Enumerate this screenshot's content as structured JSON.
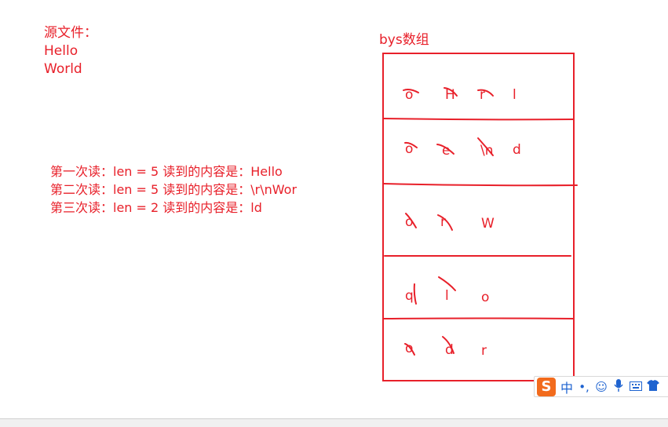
{
  "source_file": {
    "label": "源文件：",
    "lines": [
      "Hello",
      "World"
    ]
  },
  "reads": [
    "第一次读：len = 5 读到的内容是：Hello",
    "第二次读：len = 5 读到的内容是：\\r\\nWor",
    "第三次读：len = 2 读到的内容是：ld"
  ],
  "bys_array": {
    "title": "bys数组",
    "rows": [
      [
        "o",
        "H",
        "r",
        "l"
      ],
      [
        "o",
        "e",
        "\\n",
        "d"
      ],
      [
        "o",
        "r",
        "W"
      ],
      [
        "q",
        "l",
        "o"
      ],
      [
        "o",
        "d",
        "r"
      ]
    ]
  },
  "ime": {
    "logo": "S",
    "mode": "中",
    "punct": "•,",
    "icons": [
      "emoji-icon",
      "mic-icon",
      "keyboard-icon",
      "shirt-icon"
    ]
  },
  "colors": {
    "ink": "#e8202a",
    "ime_blue": "#1e63d0",
    "ime_orange": "#f26b1d"
  }
}
